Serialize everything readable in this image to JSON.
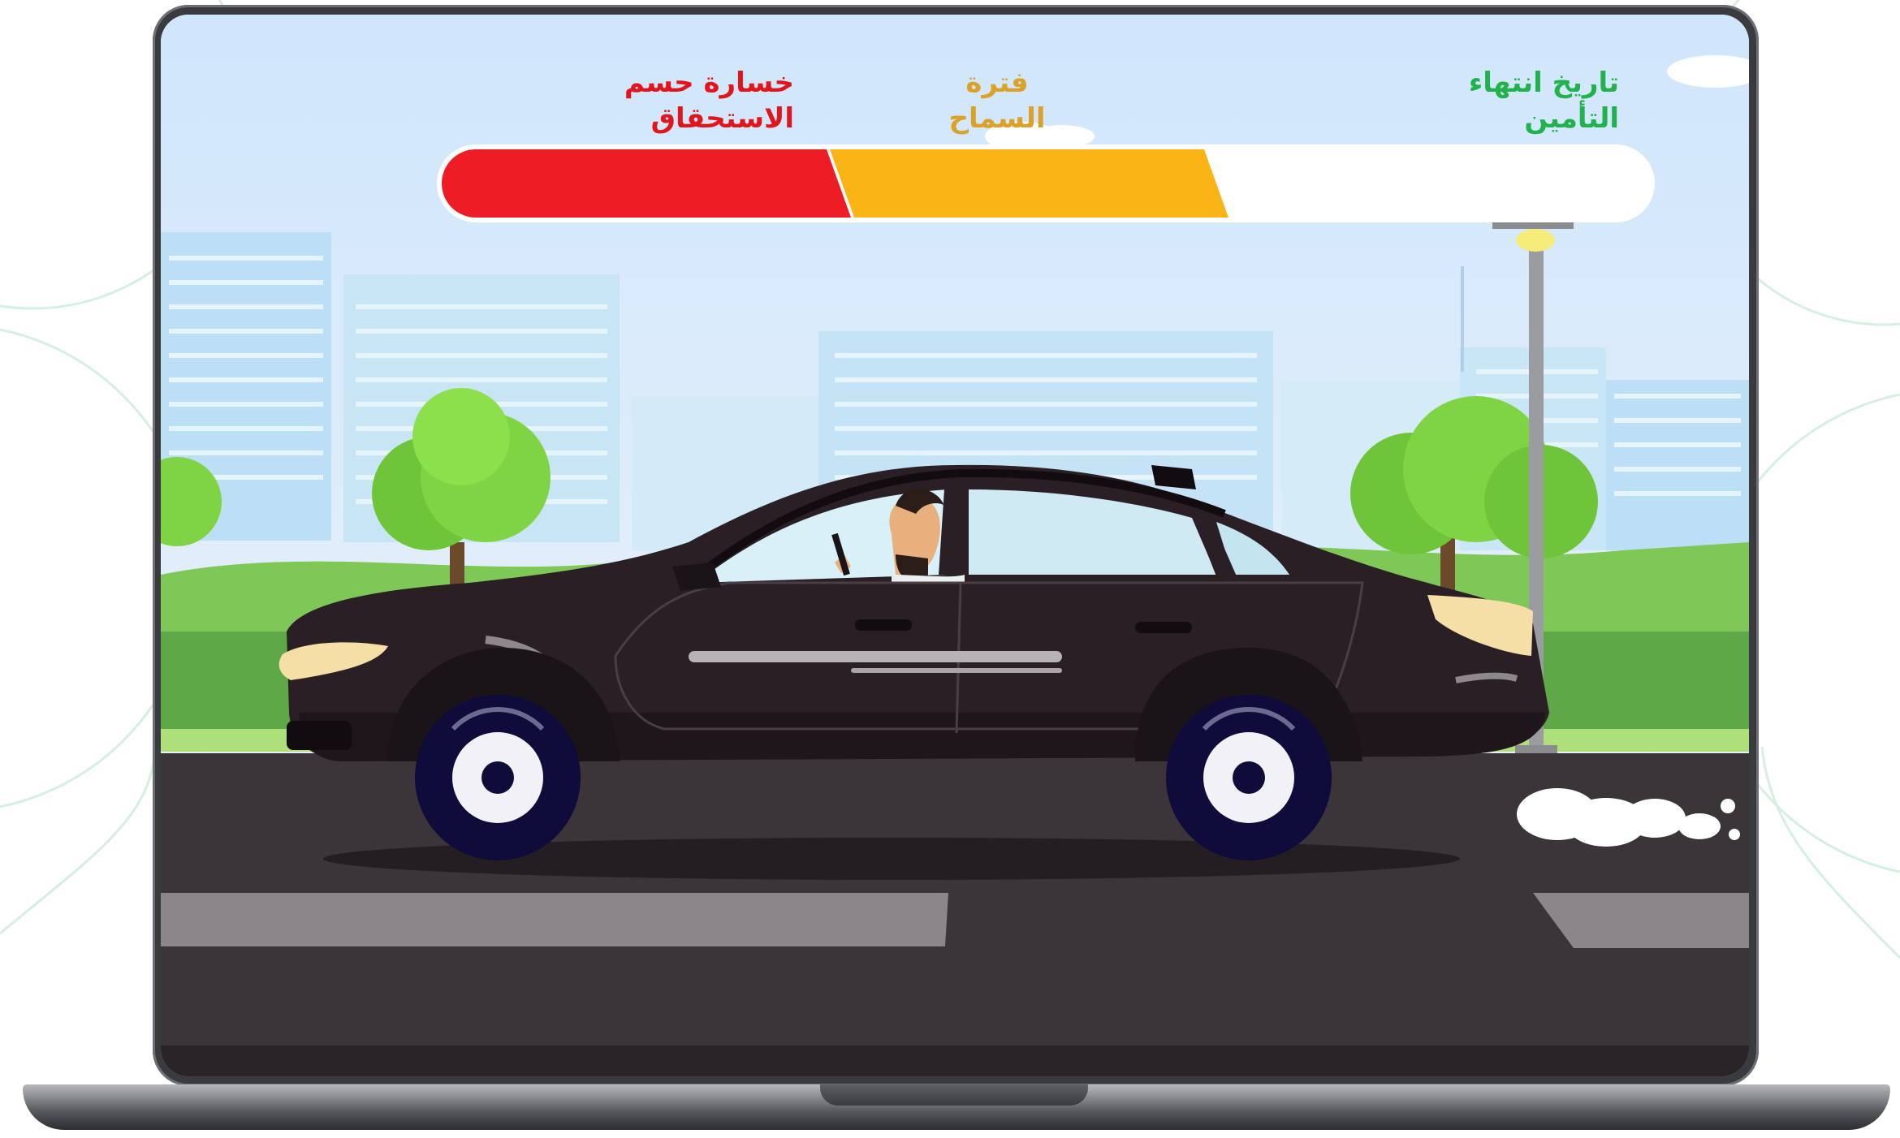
{
  "legend": {
    "expiry_line1": "تاريخ انتهاء",
    "expiry_line2": "التأمين",
    "grace_line1": "فترة",
    "grace_line2": "السماح",
    "loss_line1": "خسارة حسم",
    "loss_line2": "الاستحقاق"
  },
  "colors": {
    "expiry": "#22b24c",
    "grace": "#fbb416",
    "loss": "#ee1c24",
    "sky": "#dceefe",
    "car_body": "#2a1f25",
    "road": "#3b3539"
  },
  "grace_bar": {
    "loss_fraction": 0.33,
    "grace_fraction": 0.31,
    "remaining_fraction": 0.36
  },
  "icons": [
    "laptop",
    "car",
    "driver",
    "street-lamp",
    "tree",
    "city-skyline",
    "exhaust-smoke"
  ]
}
